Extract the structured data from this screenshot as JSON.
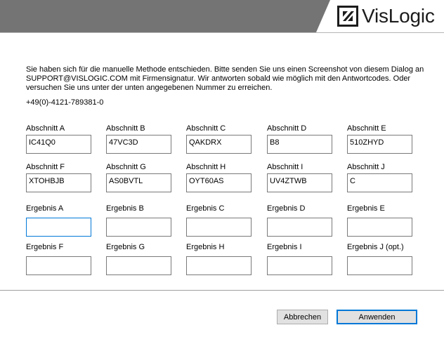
{
  "logo": {
    "text": "VisLogic"
  },
  "info": {
    "line1": "Sie haben sich für die manuelle Methode entschieden. Bitte senden Sie uns einen Screenshot von diesem Dialog an",
    "line2": "SUPPORT@VISLOGIC.COM mit Firmensignatur. Wir antworten sobald wie möglich mit den Antwortcodes. Oder",
    "line3": "versuchen Sie uns unter der unten angegebenen Nummer zu erreichen.",
    "phone": "+49(0)-4121-789381-0"
  },
  "sections": [
    {
      "label": "Abschnitt A",
      "value": "IC41Q0"
    },
    {
      "label": "Abschnitt B",
      "value": "47VC3D"
    },
    {
      "label": "Abschnitt C",
      "value": "QAKDRX"
    },
    {
      "label": "Abschnitt D",
      "value": "B8"
    },
    {
      "label": "Abschnitt E",
      "value": "510ZHYD"
    },
    {
      "label": "Abschnitt F",
      "value": "XTOHBJB"
    },
    {
      "label": "Abschnitt G",
      "value": "AS0BVTL"
    },
    {
      "label": "Abschnitt H",
      "value": "OYT60AS"
    },
    {
      "label": "Abschnitt I",
      "value": "UV4ZTWB"
    },
    {
      "label": "Abschnitt J",
      "value": "C"
    }
  ],
  "results": [
    {
      "label": "Ergebnis A",
      "value": ""
    },
    {
      "label": "Ergebnis B",
      "value": ""
    },
    {
      "label": "Ergebnis C",
      "value": ""
    },
    {
      "label": "Ergebnis D",
      "value": ""
    },
    {
      "label": "Ergebnis E",
      "value": ""
    },
    {
      "label": "Ergebnis F",
      "value": ""
    },
    {
      "label": "Ergebnis G",
      "value": ""
    },
    {
      "label": "Ergebnis H",
      "value": ""
    },
    {
      "label": "Ergebnis I",
      "value": ""
    },
    {
      "label": "Ergebnis J (opt.)",
      "value": ""
    }
  ],
  "buttons": {
    "cancel": "Abbrechen",
    "apply": "Anwenden"
  },
  "colors": {
    "header": "#747474",
    "focus": "#0078d7",
    "button": "#e1e1e1"
  }
}
